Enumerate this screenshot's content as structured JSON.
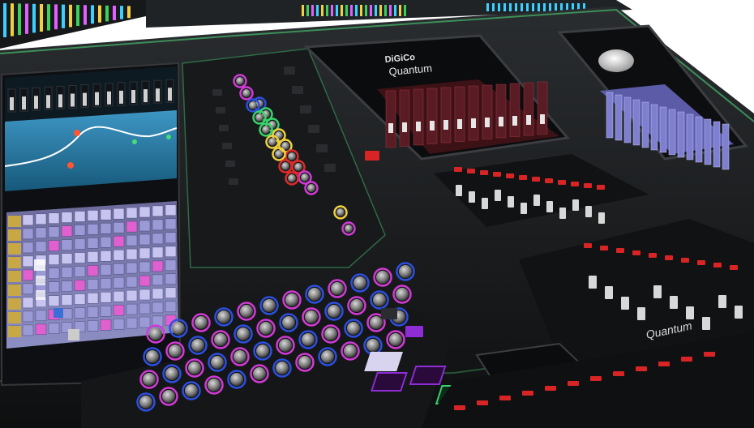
{
  "brand": {
    "logo_text": "DiGiCo",
    "model_text": "Quantum",
    "signature_text": "Quantum"
  },
  "screens": {
    "center_screen": {
      "logo_text": "DiGiCo",
      "model_text": "Quantum"
    }
  },
  "palette": {
    "panel": "#1a1c1e",
    "panel_edge": "#3c8f58",
    "screen_blue": "#2a7fa8",
    "knob_blue": "#2d4fe0",
    "knob_magenta": "#d23ad6",
    "knob_green": "#37d46a",
    "knob_yellow": "#f0d040",
    "knob_red": "#e02a2a",
    "fader_cap": "#d8d8d8"
  },
  "icons": [
    "knob-icon",
    "fader-icon",
    "button-icon"
  ]
}
